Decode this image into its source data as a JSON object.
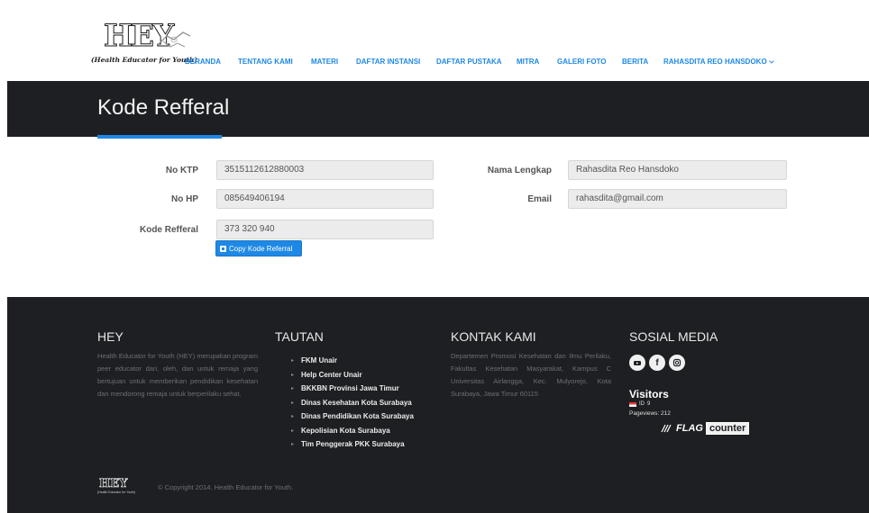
{
  "brand": {
    "logo_text": "HEY",
    "tagline": "(Health Educator for Youth)"
  },
  "nav": {
    "items": [
      "BERANDA",
      "TENTANG KAMI",
      "MATERI",
      "DAFTAR INSTANSI",
      "DAFTAR PUSTAKA",
      "MITRA",
      "GALERI FOTO",
      "BERITA",
      "RAHASDITA REO HANSDOKO"
    ],
    "user_dropdown_icon": "chevron-down-icon"
  },
  "page": {
    "title": "Kode Refferal"
  },
  "form": {
    "no_ktp_label": "No KTP",
    "no_ktp_value": "3515112612880003",
    "no_hp_label": "No HP",
    "no_hp_value": "085649406194",
    "kode_label": "Kode Refferal",
    "kode_value": "373 320 940",
    "copy_button": "Copy Kode Referral",
    "nama_label": "Nama Lengkap",
    "nama_value": "Rahasdita Reo Hansdoko",
    "email_label": "Email",
    "email_value": "rahasdita@gmail.com"
  },
  "footer": {
    "hey_title": "HEY",
    "hey_text": "Health Educator for Youth (HEY) merupakan program peer educator dari, oleh, dan untuk remaja yang bertujuan untuk memberikan pendidikan kesehatan dan mendorong remaja untuk berperilaku sehat.",
    "tautan_title": "TAUTAN",
    "tautan_links": [
      "FKM Unair",
      "Help Center Unair",
      "BKKBN Provinsi Jawa Timur",
      "Dinas Kesehatan Kota Surabaya",
      "Dinas Pendidikan Kota Surabaya",
      "Kepolisian Kota Surabaya",
      "Tim Penggerak PKK Surabaya"
    ],
    "kontak_title": "KONTAK KAMI",
    "kontak_text": "Departemen Promosi Kesehatan dan Ilmu Perilaku, Fakultas Kesehatan Masyarakat, Kampus C Universitas Airlangga, Kec. Mulyorejo, Kota Surabaya, Jawa Timur 60115",
    "sosial_title": "SOSIAL MEDIA",
    "social_icons": [
      "youtube-icon",
      "facebook-icon",
      "instagram-icon"
    ],
    "visitors_title": "Visitors",
    "visitor_country": "ID",
    "visitor_count": "9",
    "pageviews": "Pageviews: 212",
    "flag_counter_flag": "FLAG",
    "flag_counter_counter": "counter",
    "copyright": "© Copyright 2014. Health Educator for Youth.",
    "footer_logo_text": "HEY",
    "footer_logo_tagline": "(Health Educator for Youth)"
  },
  "colors": {
    "accent": "#1e88e5",
    "dark_band": "#1d1f22"
  }
}
